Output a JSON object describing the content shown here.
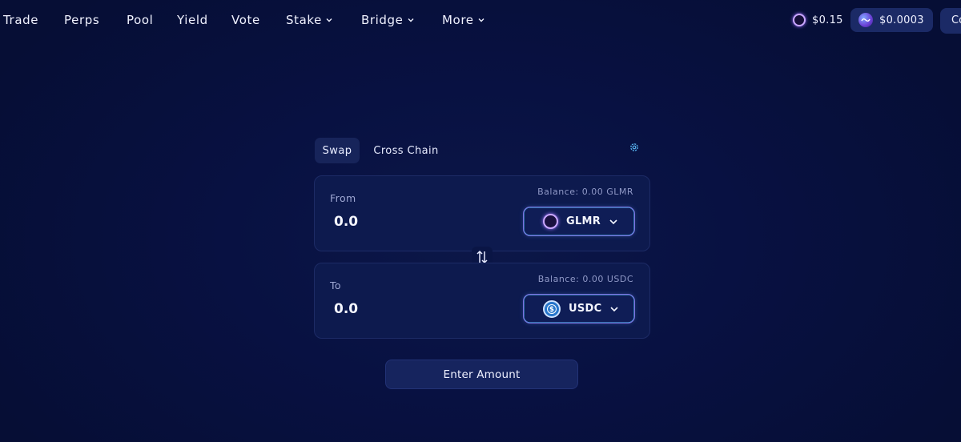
{
  "nav": {
    "items": [
      {
        "label": "Trade"
      },
      {
        "label": "Perps"
      },
      {
        "label": "Pool"
      },
      {
        "label": "Yield"
      },
      {
        "label": "Vote"
      },
      {
        "label": "Stake",
        "dropdown": true
      },
      {
        "label": "Bridge",
        "dropdown": true
      },
      {
        "label": "More",
        "dropdown": true
      }
    ],
    "glmr_price": "$0.15",
    "well_price": "$0.0003",
    "connect_label": "Co"
  },
  "swap": {
    "tabs": [
      {
        "label": "Swap",
        "active": true
      },
      {
        "label": "Cross Chain",
        "active": false
      }
    ],
    "from": {
      "label": "From",
      "balance": "Balance: 0.00 GLMR",
      "amount": "0.0",
      "token": "GLMR"
    },
    "to": {
      "label": "To",
      "balance": "Balance: 0.00 USDC",
      "amount": "0.0",
      "token": "USDC"
    },
    "action_label": "Enter Amount"
  },
  "colors": {
    "background": "#07103a",
    "card": "#0d1a4e",
    "accent_border": "#7f6fe0",
    "glmr_ring": "#c9a7ff",
    "usdc_blue": "#2775ca"
  }
}
